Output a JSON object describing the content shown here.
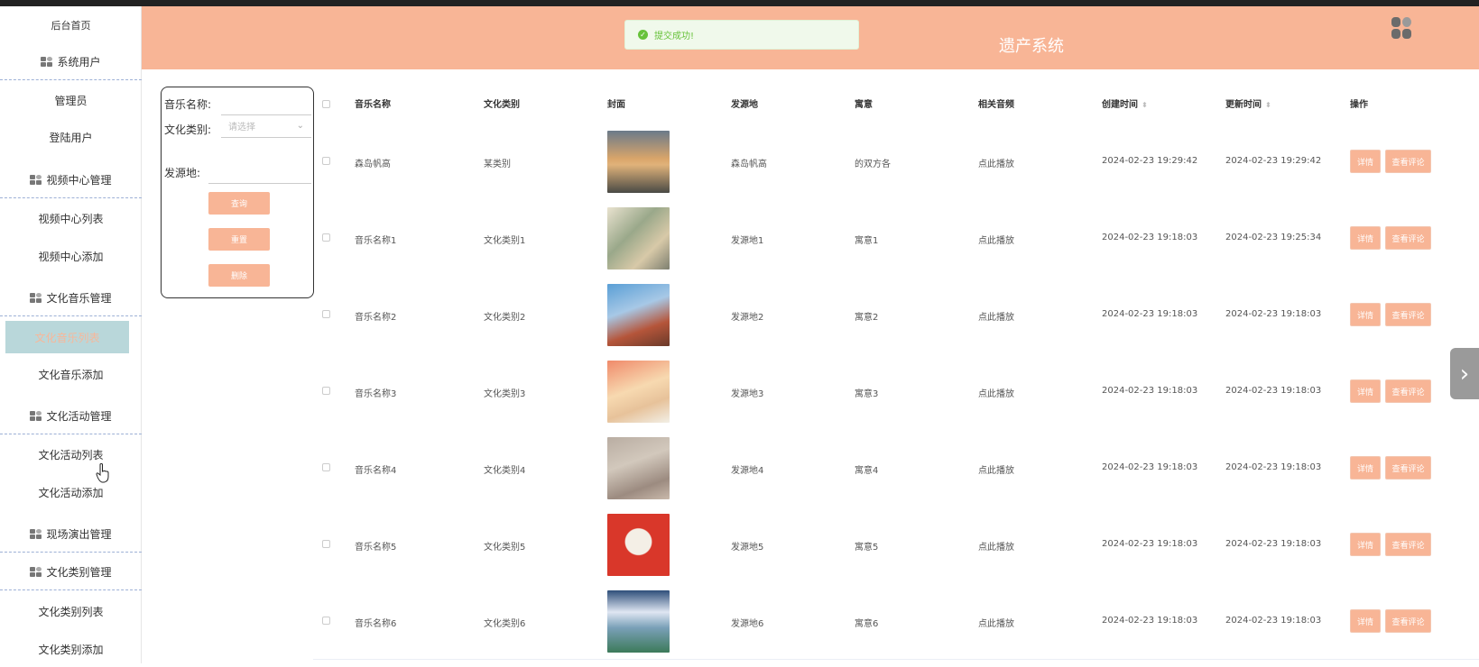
{
  "sidebar": {
    "items": [
      {
        "label": "后台首页",
        "type": "link"
      },
      {
        "label": "系统用户",
        "type": "group"
      },
      {
        "label": "管理员",
        "type": "link"
      },
      {
        "label": "登陆用户",
        "type": "link"
      },
      {
        "label": "视频中心管理",
        "type": "group"
      },
      {
        "label": "视频中心列表",
        "type": "link"
      },
      {
        "label": "视频中心添加",
        "type": "link"
      },
      {
        "label": "文化音乐管理",
        "type": "group"
      },
      {
        "label": "文化音乐列表",
        "type": "link",
        "active": true
      },
      {
        "label": "文化音乐添加",
        "type": "link"
      },
      {
        "label": "文化活动管理",
        "type": "group"
      },
      {
        "label": "文化活动列表",
        "type": "link"
      },
      {
        "label": "文化活动添加",
        "type": "link"
      },
      {
        "label": "现场演出管理",
        "type": "group"
      },
      {
        "label": "文化类别管理",
        "type": "group"
      },
      {
        "label": "文化类别列表",
        "type": "link"
      },
      {
        "label": "文化类别添加",
        "type": "link"
      }
    ]
  },
  "header": {
    "title_visible": "遗产系统",
    "logo_icon": "grid-logo-icon",
    "background": "#f8b596"
  },
  "toast": {
    "message": "提交成功!",
    "icon": "check-circle-icon",
    "color": "#67c23a"
  },
  "search": {
    "music_name_label": "音乐名称:",
    "culture_type_label": "文化类别:",
    "culture_type_placeholder": "请选择",
    "origin_label": "发源地:",
    "query_button": "查询",
    "reset_button": "重置",
    "delete_button": "删除"
  },
  "table": {
    "columns": {
      "music_name": "音乐名称",
      "culture_type": "文化类别",
      "cover": "封面",
      "origin": "发源地",
      "meaning": "寓意",
      "audio": "相关音频",
      "created": "创建时间",
      "updated": "更新时间",
      "actions": "操作"
    },
    "detail_label": "详情",
    "comment_label": "查看评论",
    "rows": [
      {
        "name": "森岛帆高",
        "type": "某类别",
        "origin": "森岛帆高",
        "meaning": "的双方各",
        "audio": "点此播放",
        "created": "2024-02-23 19:29:42",
        "updated": "2024-02-23 19:29:42"
      },
      {
        "name": "音乐名称1",
        "type": "文化类别1",
        "origin": "发源地1",
        "meaning": "寓意1",
        "audio": "点此播放",
        "created": "2024-02-23 19:18:03",
        "updated": "2024-02-23 19:25:34"
      },
      {
        "name": "音乐名称2",
        "type": "文化类别2",
        "origin": "发源地2",
        "meaning": "寓意2",
        "audio": "点此播放",
        "created": "2024-02-23 19:18:03",
        "updated": "2024-02-23 19:18:03"
      },
      {
        "name": "音乐名称3",
        "type": "文化类别3",
        "origin": "发源地3",
        "meaning": "寓意3",
        "audio": "点此播放",
        "created": "2024-02-23 19:18:03",
        "updated": "2024-02-23 19:18:03"
      },
      {
        "name": "音乐名称4",
        "type": "文化类别4",
        "origin": "发源地4",
        "meaning": "寓意4",
        "audio": "点此播放",
        "created": "2024-02-23 19:18:03",
        "updated": "2024-02-23 19:18:03"
      },
      {
        "name": "音乐名称5",
        "type": "文化类别5",
        "origin": "发源地5",
        "meaning": "寓意5",
        "audio": "点此播放",
        "created": "2024-02-23 19:18:03",
        "updated": "2024-02-23 19:18:03"
      },
      {
        "name": "音乐名称6",
        "type": "文化类别6",
        "origin": "发源地6",
        "meaning": "寓意6",
        "audio": "点此播放",
        "created": "2024-02-23 19:18:03",
        "updated": "2024-02-23 19:18:03"
      }
    ]
  },
  "colors": {
    "accent": "#f8b596",
    "active_bg": "#b9d7da",
    "active_text": "#f8b799"
  }
}
